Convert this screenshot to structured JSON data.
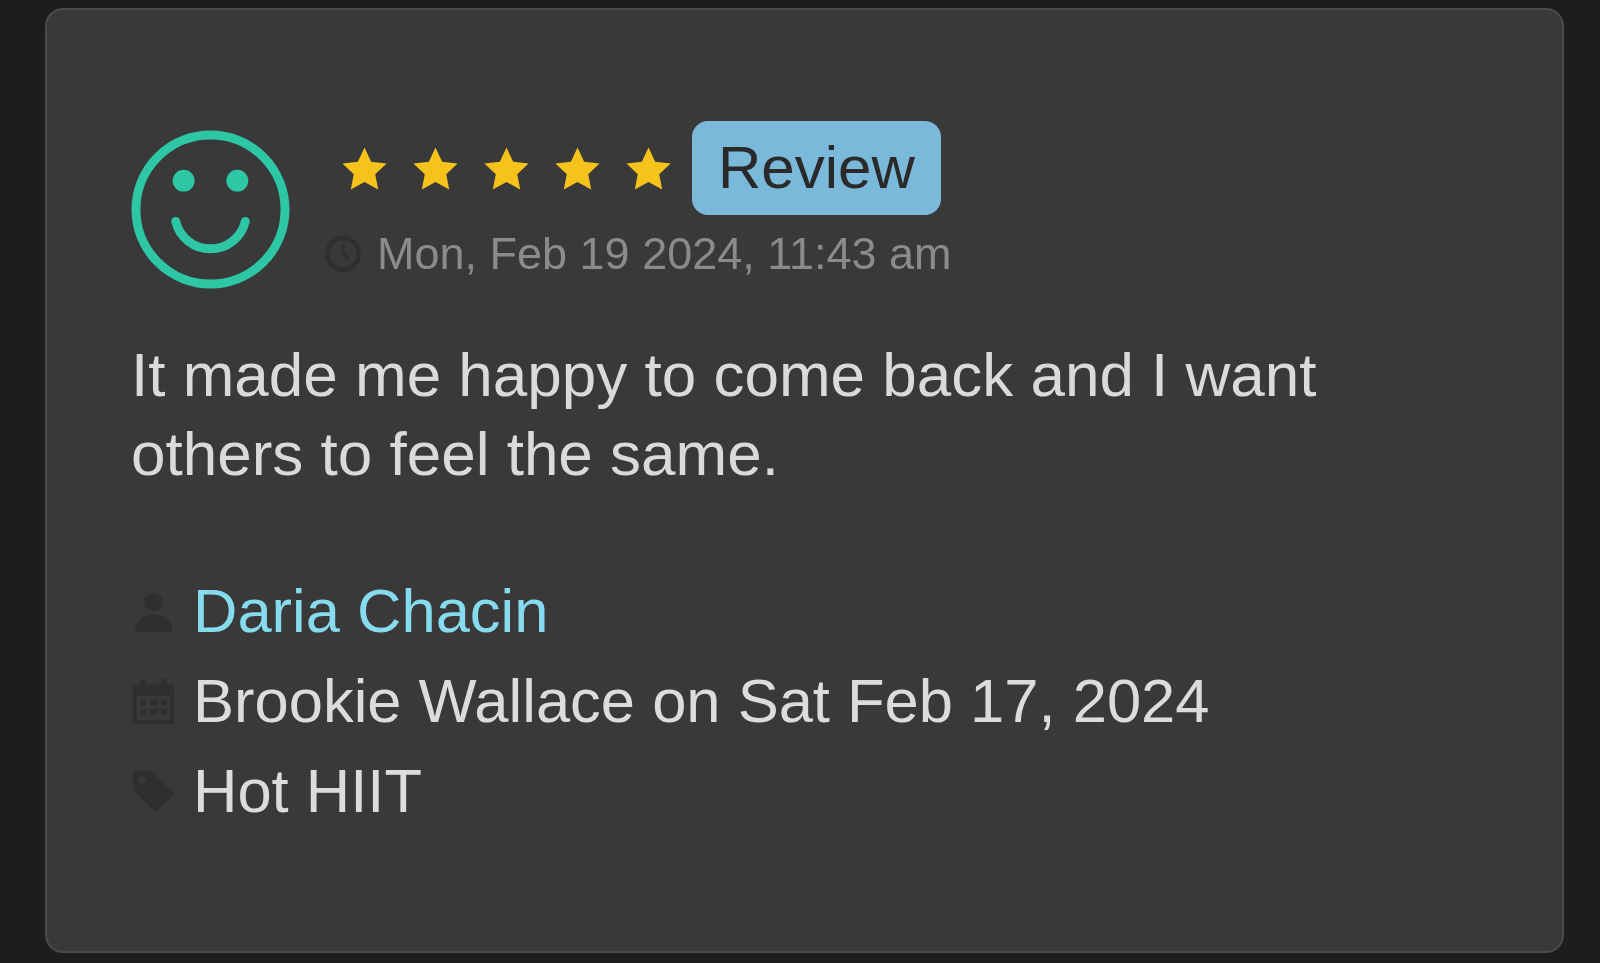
{
  "review": {
    "stars": 5,
    "badge": "Review",
    "timestamp": "Mon, Feb 19 2024, 11:43 am",
    "text": "It made me happy to come back and I want others to feel the same.",
    "details": [
      {
        "kind": "person",
        "text": "Daria Chacin"
      },
      {
        "kind": "date",
        "text": "Brookie Wallace on Sat Feb 17, 2024"
      },
      {
        "kind": "tag",
        "text": "Hot HIIT"
      }
    ]
  }
}
